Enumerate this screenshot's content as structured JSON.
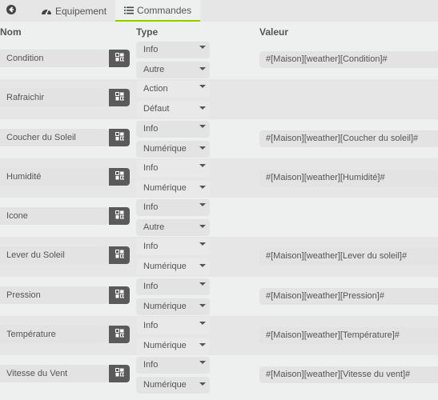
{
  "tabs": {
    "back": {
      "icon": "back-arrow-circle-icon"
    },
    "items": [
      {
        "label": "Equipement",
        "icon": "dashboard-gauge-icon",
        "active": false
      },
      {
        "label": "Commandes",
        "icon": "list-icon",
        "active": true
      }
    ]
  },
  "columns": {
    "name": "Nom",
    "type": "Type",
    "value": "Valeur"
  },
  "accent_color": "#94ca02",
  "commands": [
    {
      "name": "Condition",
      "type": "Info",
      "subtype": "Autre",
      "value": "#[Maison][weather][Condition]#"
    },
    {
      "name": "Rafraichir",
      "type": "Action",
      "subtype": "Défaut",
      "value": ""
    },
    {
      "name": "Coucher du Soleil",
      "type": "Info",
      "subtype": "Numérique",
      "value": "#[Maison][weather][Coucher du soleil]#"
    },
    {
      "name": "Humidité",
      "type": "Info",
      "subtype": "Numérique",
      "value": "#[Maison][weather][Humidité]#"
    },
    {
      "name": "Icone",
      "type": "Info",
      "subtype": "Autre",
      "value": ""
    },
    {
      "name": "Lever du Soleil",
      "type": "Info",
      "subtype": "Numérique",
      "value": "#[Maison][weather][Lever du soleil]#"
    },
    {
      "name": "Pression",
      "type": "Info",
      "subtype": "Numérique",
      "value": "#[Maison][weather][Pression]#"
    },
    {
      "name": "Température",
      "type": "Info",
      "subtype": "Numérique",
      "value": "#[Maison][weather][Température]#"
    },
    {
      "name": "Vitesse du Vent",
      "type": "Info",
      "subtype": "Numérique",
      "value": "#[Maison][weather][Vitesse du vent]#"
    }
  ]
}
